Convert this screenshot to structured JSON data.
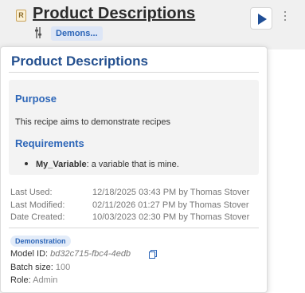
{
  "header": {
    "title": "Product Descriptions",
    "recipe_icon_letter": "R",
    "recipe_icon": "recipe-file-icon",
    "settings_icon": "sliders-icon",
    "tag_label": "Demons...",
    "run_icon": "play-icon",
    "more_icon": "vertical-dots-icon"
  },
  "popover": {
    "title": "Product Descriptions",
    "purpose_heading": "Purpose",
    "purpose_text": "This recipe aims to demonstrate recipes",
    "requirements_heading": "Requirements",
    "requirements": [
      {
        "name": "My_Variable",
        "description": ": a variable that is mine."
      }
    ],
    "meta": {
      "last_used_label": "Last Used:",
      "last_used_value": "12/18/2025 03:43 PM by Thomas Stover",
      "last_modified_label": "Last Modified:",
      "last_modified_value": "02/11/2026 01:27 PM by Thomas Stover",
      "date_created_label": "Date Created:",
      "date_created_value": "10/03/2023 02:30 PM by Thomas Stover"
    },
    "badge": "Demonstration",
    "model_id_label": "Model ID:",
    "model_id_value": "bd32c715-fbc4-4edb",
    "copy_icon": "copy-icon",
    "batch_size_label": "Batch size:",
    "batch_size_value": "100",
    "role_label": "Role:",
    "role_value": "Admin"
  },
  "colors": {
    "accent_blue": "#2d66b8",
    "title_blue": "#24508f",
    "header_bg": "#f0f0f0",
    "chip_bg": "#dde6f6"
  }
}
